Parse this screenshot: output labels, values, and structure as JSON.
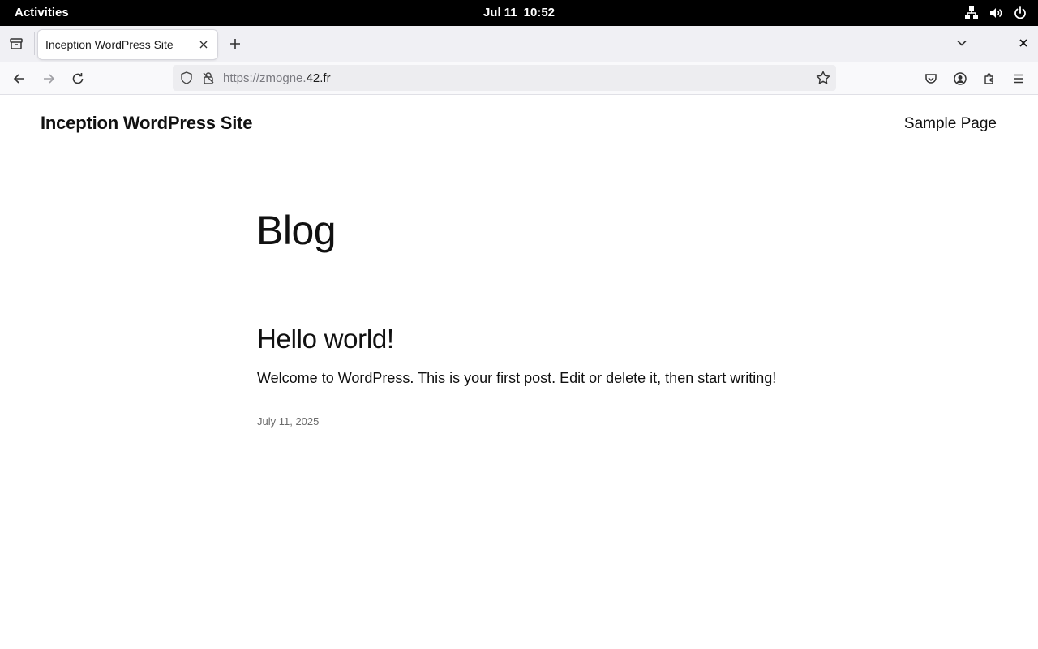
{
  "system_bar": {
    "activities": "Activities",
    "date": "Jul 11",
    "time": "10:52",
    "tray_icons": [
      "network-icon",
      "volume-icon",
      "power-icon"
    ]
  },
  "browser": {
    "tab": {
      "title": "Inception WordPress Site"
    },
    "url": {
      "prefix": "https://zmogne.",
      "domain": "42.fr"
    }
  },
  "page": {
    "site_title": "Inception WordPress Site",
    "nav_items": [
      "Sample Page"
    ],
    "heading": "Blog",
    "posts": [
      {
        "title": "Hello world!",
        "excerpt": "Welcome to WordPress. This is your first post. Edit or delete it, then start writing!",
        "date": "July 11, 2025"
      }
    ]
  },
  "colors": {
    "topbar_bg": "#000000",
    "tabstrip_bg": "#f0f0f4",
    "urlbar_bg": "#ededf0",
    "text": "#111111",
    "muted_text": "#6b6b6b"
  }
}
